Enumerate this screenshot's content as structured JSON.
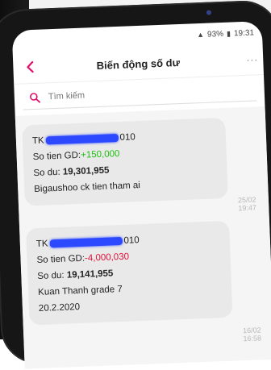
{
  "status_bar": {
    "signal_icon": "signal-icon",
    "battery": "93%",
    "time": "19:31"
  },
  "header": {
    "title": "Biến động số dư",
    "more": "..."
  },
  "search": {
    "placeholder": "Tìm kiếm"
  },
  "messages": [
    {
      "account_prefix": "TK",
      "account_suffix": "010",
      "amount_label": "So tien GD:",
      "amount_value": "+150,000",
      "balance_label": "So du:",
      "balance_value": "19,301,955",
      "description": "Bigaushoo ck tien tham ai",
      "description2": "",
      "timestamp": "25/02 19:47"
    },
    {
      "account_prefix": "TK",
      "account_suffix": "010",
      "amount_label": "So tien GD:",
      "amount_value": "-4,000,030",
      "balance_label": "So du:",
      "balance_value": "19,141,955",
      "description": "Kuan Thanh grade 7",
      "description2": "20.2.2020",
      "timestamp": "16/02 16:58"
    }
  ],
  "colors": {
    "accent": "#e0106a",
    "credit": "#1ec00f",
    "debit": "#e0103a",
    "redaction": "#2c49ff"
  }
}
